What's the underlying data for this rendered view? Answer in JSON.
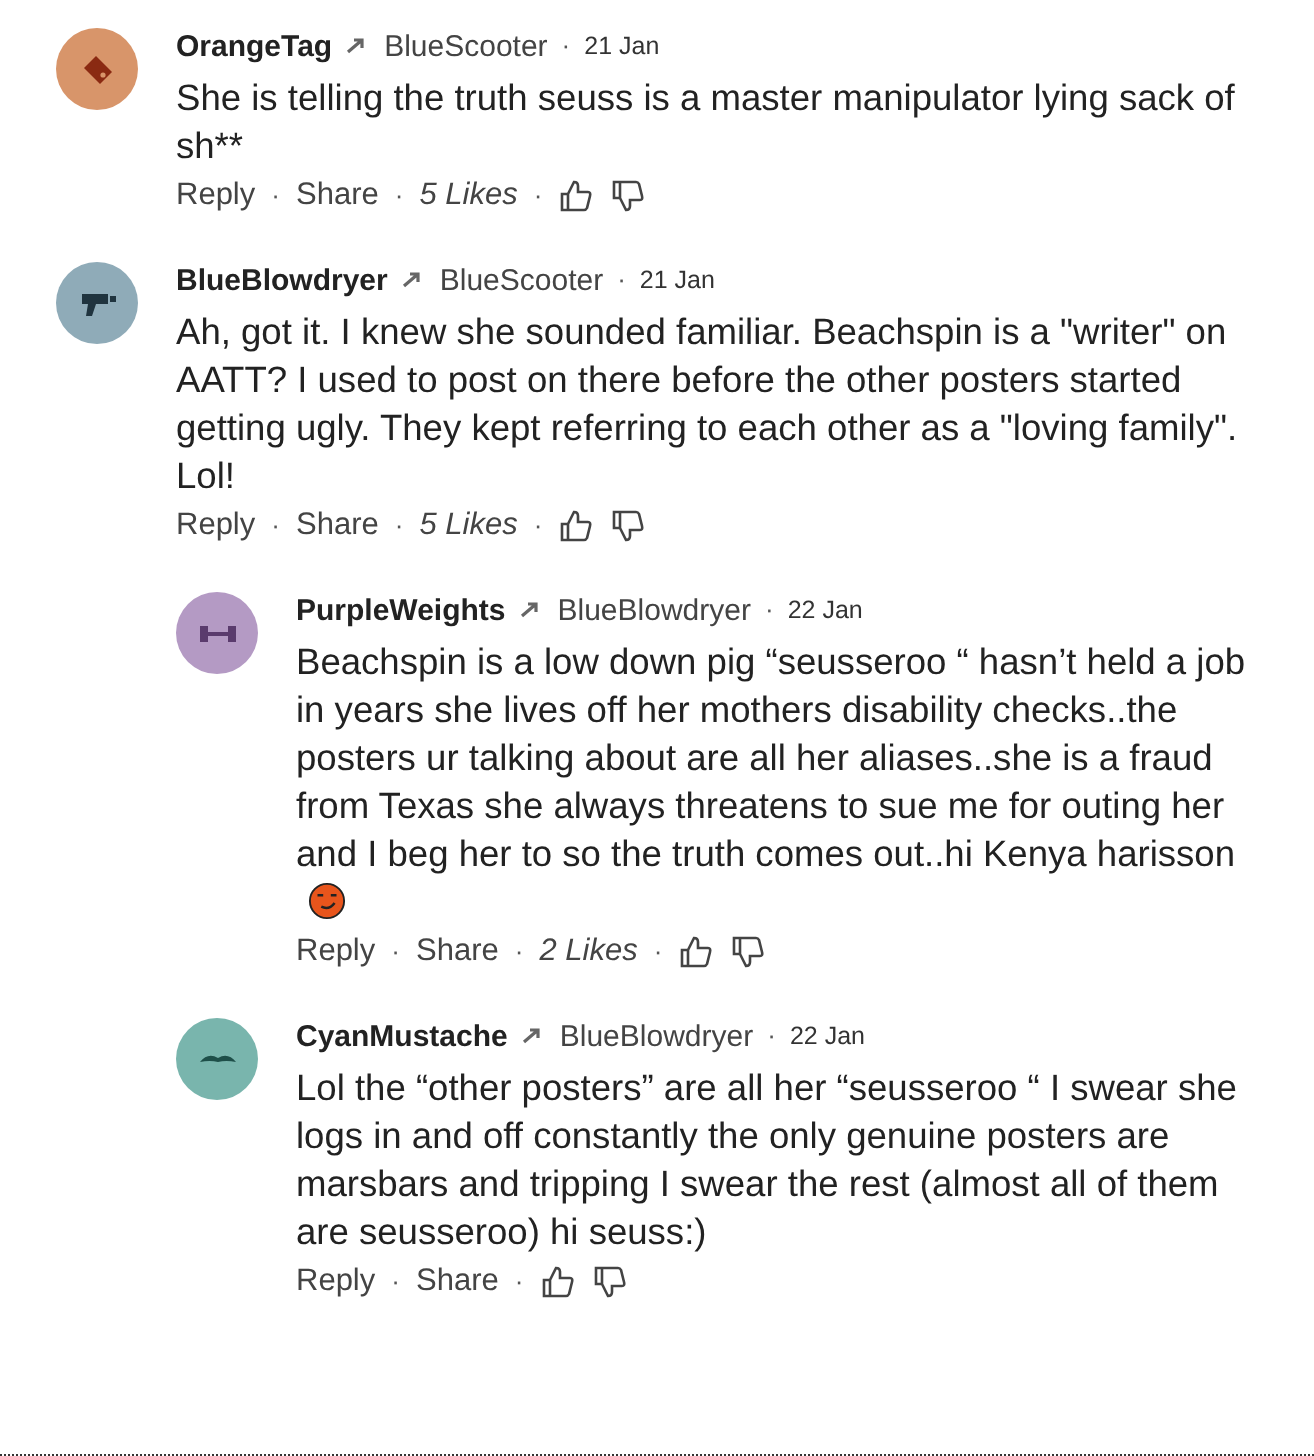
{
  "comments": [
    {
      "author": "OrangeTag",
      "kind": "tag",
      "color": "#d8956a",
      "reply_to": "BlueScooter",
      "separator": "·",
      "date": "21 Jan",
      "text": "She is telling the truth seuss is a master manipulator lying sack of sh**",
      "emoji": false,
      "footer": [
        {
          "kind": "link",
          "text": "Reply"
        },
        {
          "kind": "separator",
          "text": "·"
        },
        {
          "kind": "link",
          "text": "Share"
        },
        {
          "kind": "separator",
          "text": "·"
        },
        {
          "kind": "likes",
          "text": "5 Likes"
        },
        {
          "kind": "separator",
          "text": "·"
        }
      ]
    },
    {
      "author": "BlueBlowdryer",
      "kind": "blowdryer",
      "color": "#8fabb8",
      "reply_to": "BlueScooter",
      "separator": "·",
      "date": "21 Jan",
      "text": "Ah, got it.  I knew she sounded familiar.  Beachspin is a \"writer\" on AATT?  I used to post on there before the other posters started getting ugly.  They kept referring to each other as a \"loving family\".  Lol!",
      "emoji": false,
      "footer": [
        {
          "kind": "link",
          "text": "Reply"
        },
        {
          "kind": "separator",
          "text": "·"
        },
        {
          "kind": "link",
          "text": "Share"
        },
        {
          "kind": "separator",
          "text": "·"
        },
        {
          "kind": "likes",
          "text": "5 Likes"
        },
        {
          "kind": "separator",
          "text": "·"
        }
      ],
      "children": [
        {
          "author": "PurpleWeights",
          "kind": "weights",
          "color": "#b49ac4",
          "reply_to": "BlueBlowdryer",
          "separator": "·",
          "date": "22 Jan",
          "text": "Beachspin is a low down pig “seusseroo “ hasn’t held a job in years she lives off her mothers disability checks..the posters ur talking about are all her aliases..she is a fraud from Texas she always threatens to sue me for outing her and I beg her to so the truth comes out..hi Kenya harisson",
          "emoji": true,
          "footer": [
            {
              "kind": "link",
              "text": "Reply"
            },
            {
              "kind": "separator",
              "text": "·"
            },
            {
              "kind": "link",
              "text": "Share"
            },
            {
              "kind": "separator",
              "text": "·"
            },
            {
              "kind": "likes",
              "text": "2 Likes"
            },
            {
              "kind": "separator",
              "text": "·"
            }
          ]
        },
        {
          "author": "CyanMustache",
          "kind": "mustache",
          "color": "#79b5ad",
          "reply_to": "BlueBlowdryer",
          "separator": "·",
          "date": "22 Jan",
          "text": "Lol the “other posters” are all her “seusseroo “  I swear she logs in and off constantly  the only genuine posters are marsbars and tripping I swear the rest (almost all of them are seusseroo) hi seuss:)",
          "emoji": false,
          "footer": [
            {
              "kind": "link",
              "text": "Reply"
            },
            {
              "kind": "separator",
              "text": "·"
            },
            {
              "kind": "link",
              "text": "Share"
            },
            {
              "kind": "separator",
              "text": "·"
            }
          ]
        }
      ]
    }
  ]
}
